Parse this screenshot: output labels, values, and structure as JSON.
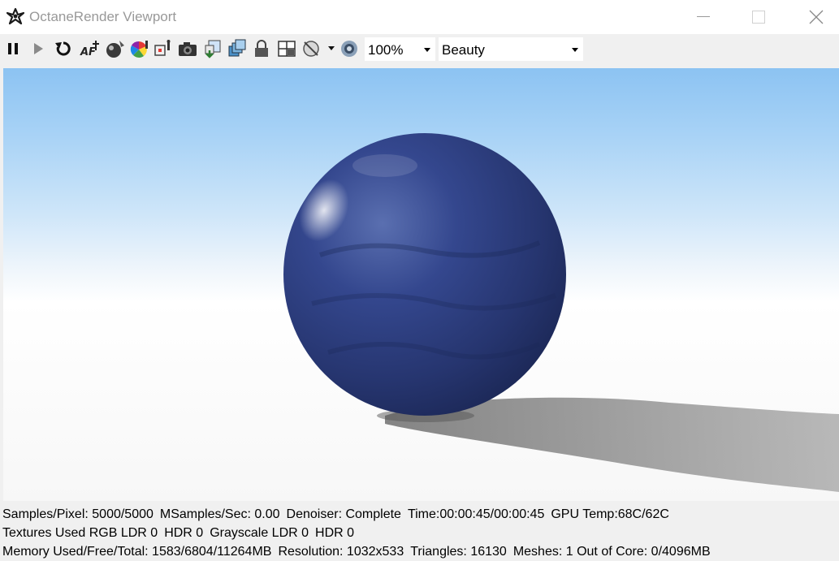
{
  "window": {
    "title": "OctaneRender Viewport"
  },
  "toolbar": {
    "buttons": [
      "pause-icon",
      "play-icon",
      "restart-icon",
      "autofocus-icon",
      "material-picker-icon",
      "color-picker-icon",
      "focus-picker-icon",
      "camera-icon",
      "export-icon",
      "layers-icon",
      "lock-icon",
      "region-icon",
      "clay-mode-icon",
      "settings-icon"
    ],
    "zoom": "100%",
    "render_pass": "Beauty"
  },
  "status": {
    "samples": "Samples/Pixel: 5000/5000",
    "msamples": "MSamples/Sec: 0.00",
    "denoiser": "Denoiser: Complete",
    "time": "Time:00:00:45/00:00:45",
    "gpu_temp": "GPU Temp:68C/62C",
    "textures_rgb": "Textures Used RGB LDR 0",
    "textures_hdr": "HDR 0",
    "textures_gray": "Grayscale LDR 0",
    "textures_gray_hdr": "HDR 0",
    "memory": "Memory Used/Free/Total: 1583/6804/11264MB",
    "resolution": "Resolution: 1032x533",
    "triangles": "Triangles: 16130",
    "meshes": "Meshes: 1",
    "out_of_core": "Out of Core: 0/4096MB"
  },
  "colors": {
    "sphere": "#2b3a7e",
    "sky": "#8cc3f2",
    "ground": "#f7f7f7",
    "shadow": "#9a9a9a"
  }
}
